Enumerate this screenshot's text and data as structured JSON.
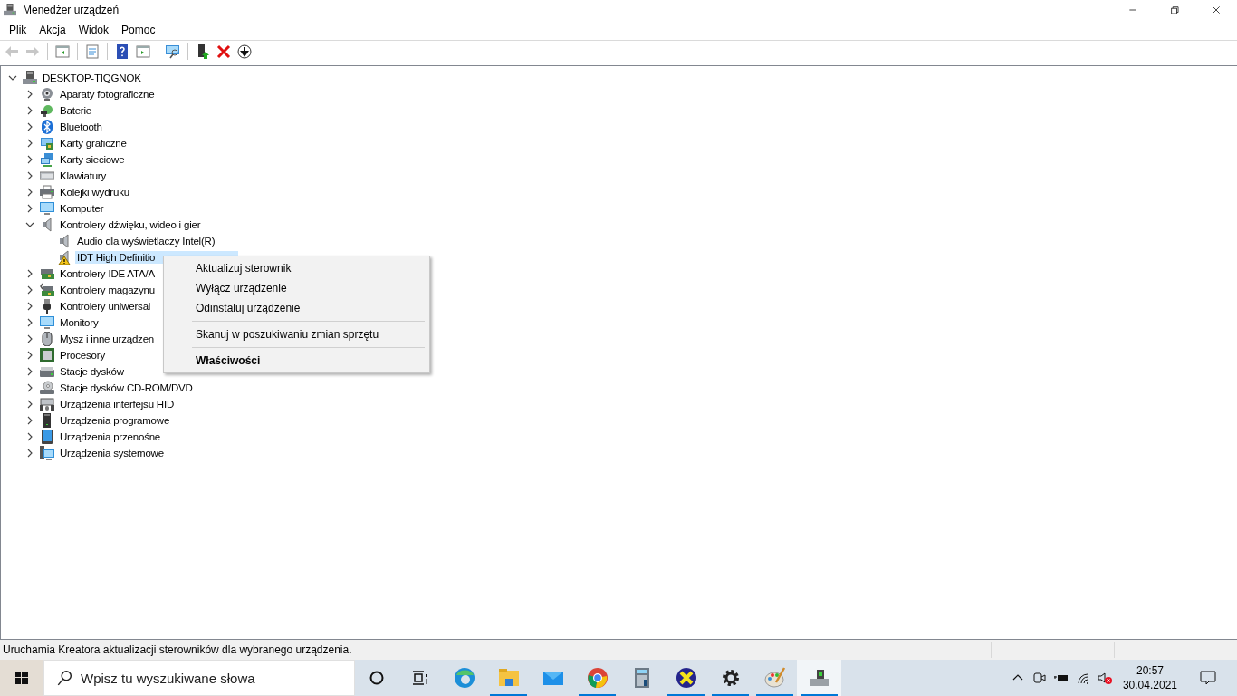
{
  "window": {
    "title": "Menedżer urządzeń"
  },
  "menu": [
    "Plik",
    "Akcja",
    "Widok",
    "Pomoc"
  ],
  "toolbar": [
    {
      "disabled": true
    },
    {
      "disabled": true
    },
    {
      "disabled": false
    },
    {
      "disabled": false
    },
    {
      "disabled": false
    },
    {
      "disabled": false
    },
    {
      "disabled": false
    },
    {
      "disabled": false
    },
    {
      "disabled": false
    },
    {
      "disabled": false
    }
  ],
  "tree": {
    "label": "DESKTOP-TIQGNOK",
    "expanded": true,
    "selected": false,
    "children": [
      {
        "label": "Aparaty fotograficzne",
        "expanded": false,
        "selected": false
      },
      {
        "label": "Baterie",
        "expanded": false,
        "selected": false
      },
      {
        "label": "Bluetooth",
        "expanded": false,
        "selected": false
      },
      {
        "label": "Karty graficzne",
        "expanded": false,
        "selected": false
      },
      {
        "label": "Karty sieciowe",
        "expanded": false,
        "selected": false
      },
      {
        "label": "Klawiatury",
        "expanded": false,
        "selected": false
      },
      {
        "label": "Kolejki wydruku",
        "expanded": false,
        "selected": false
      },
      {
        "label": "Komputer",
        "expanded": false,
        "selected": false
      },
      {
        "label": "Kontrolery dźwięku, wideo i gier",
        "expanded": true,
        "selected": false,
        "children": [
          {
            "label": "Audio dla wyświetlaczy Intel(R)",
            "selected": false,
            "warning": false
          },
          {
            "label": "IDT High Definitio",
            "selected": true,
            "warning": true
          }
        ]
      },
      {
        "label": "Kontrolery IDE ATA/A",
        "expanded": false,
        "selected": false
      },
      {
        "label": "Kontrolery magazynu",
        "expanded": false,
        "selected": false
      },
      {
        "label": "Kontrolery uniwersal",
        "expanded": false,
        "selected": false
      },
      {
        "label": "Monitory",
        "expanded": false,
        "selected": false
      },
      {
        "label": "Mysz i inne urządzen",
        "expanded": false,
        "selected": false
      },
      {
        "label": "Procesory",
        "expanded": false,
        "selected": false
      },
      {
        "label": "Stacje dysków",
        "expanded": false,
        "selected": false
      },
      {
        "label": "Stacje dysków CD-ROM/DVD",
        "expanded": false,
        "selected": false
      },
      {
        "label": "Urządzenia interfejsu HID",
        "expanded": false,
        "selected": false
      },
      {
        "label": "Urządzenia programowe",
        "expanded": false,
        "selected": false
      },
      {
        "label": "Urządzenia przenośne",
        "expanded": false,
        "selected": false
      },
      {
        "label": "Urządzenia systemowe",
        "expanded": false,
        "selected": false
      }
    ]
  },
  "context_menu": {
    "items": [
      {
        "kind": "item",
        "label": "Aktualizuj sterownik",
        "default": false
      },
      {
        "kind": "item",
        "label": "Wyłącz urządzenie",
        "default": false
      },
      {
        "kind": "item",
        "label": "Odinstaluj urządzenie",
        "default": false
      },
      {
        "kind": "separator"
      },
      {
        "kind": "item",
        "label": "Skanuj w poszukiwaniu zmian sprzętu",
        "default": false
      },
      {
        "kind": "separator"
      },
      {
        "kind": "item",
        "label": "Właściwości",
        "default": true
      }
    ]
  },
  "status_bar": {
    "text": "Uruchamia Kreatora aktualizacji sterowników dla wybranego urządzenia."
  },
  "taskbar": {
    "search": {
      "placeholder": "Wpisz tu wyszukiwane słowa"
    },
    "apps": [
      {
        "running": false,
        "selected": false
      },
      {
        "running": true,
        "selected": false
      },
      {
        "running": false,
        "selected": false
      },
      {
        "running": true,
        "selected": false
      },
      {
        "running": false,
        "selected": false
      },
      {
        "running": true,
        "selected": false
      },
      {
        "running": true,
        "selected": false
      },
      {
        "running": true,
        "selected": false
      },
      {
        "running": true,
        "selected": true
      }
    ],
    "clock": {
      "time": "20:57",
      "date": "30.04.2021"
    }
  }
}
